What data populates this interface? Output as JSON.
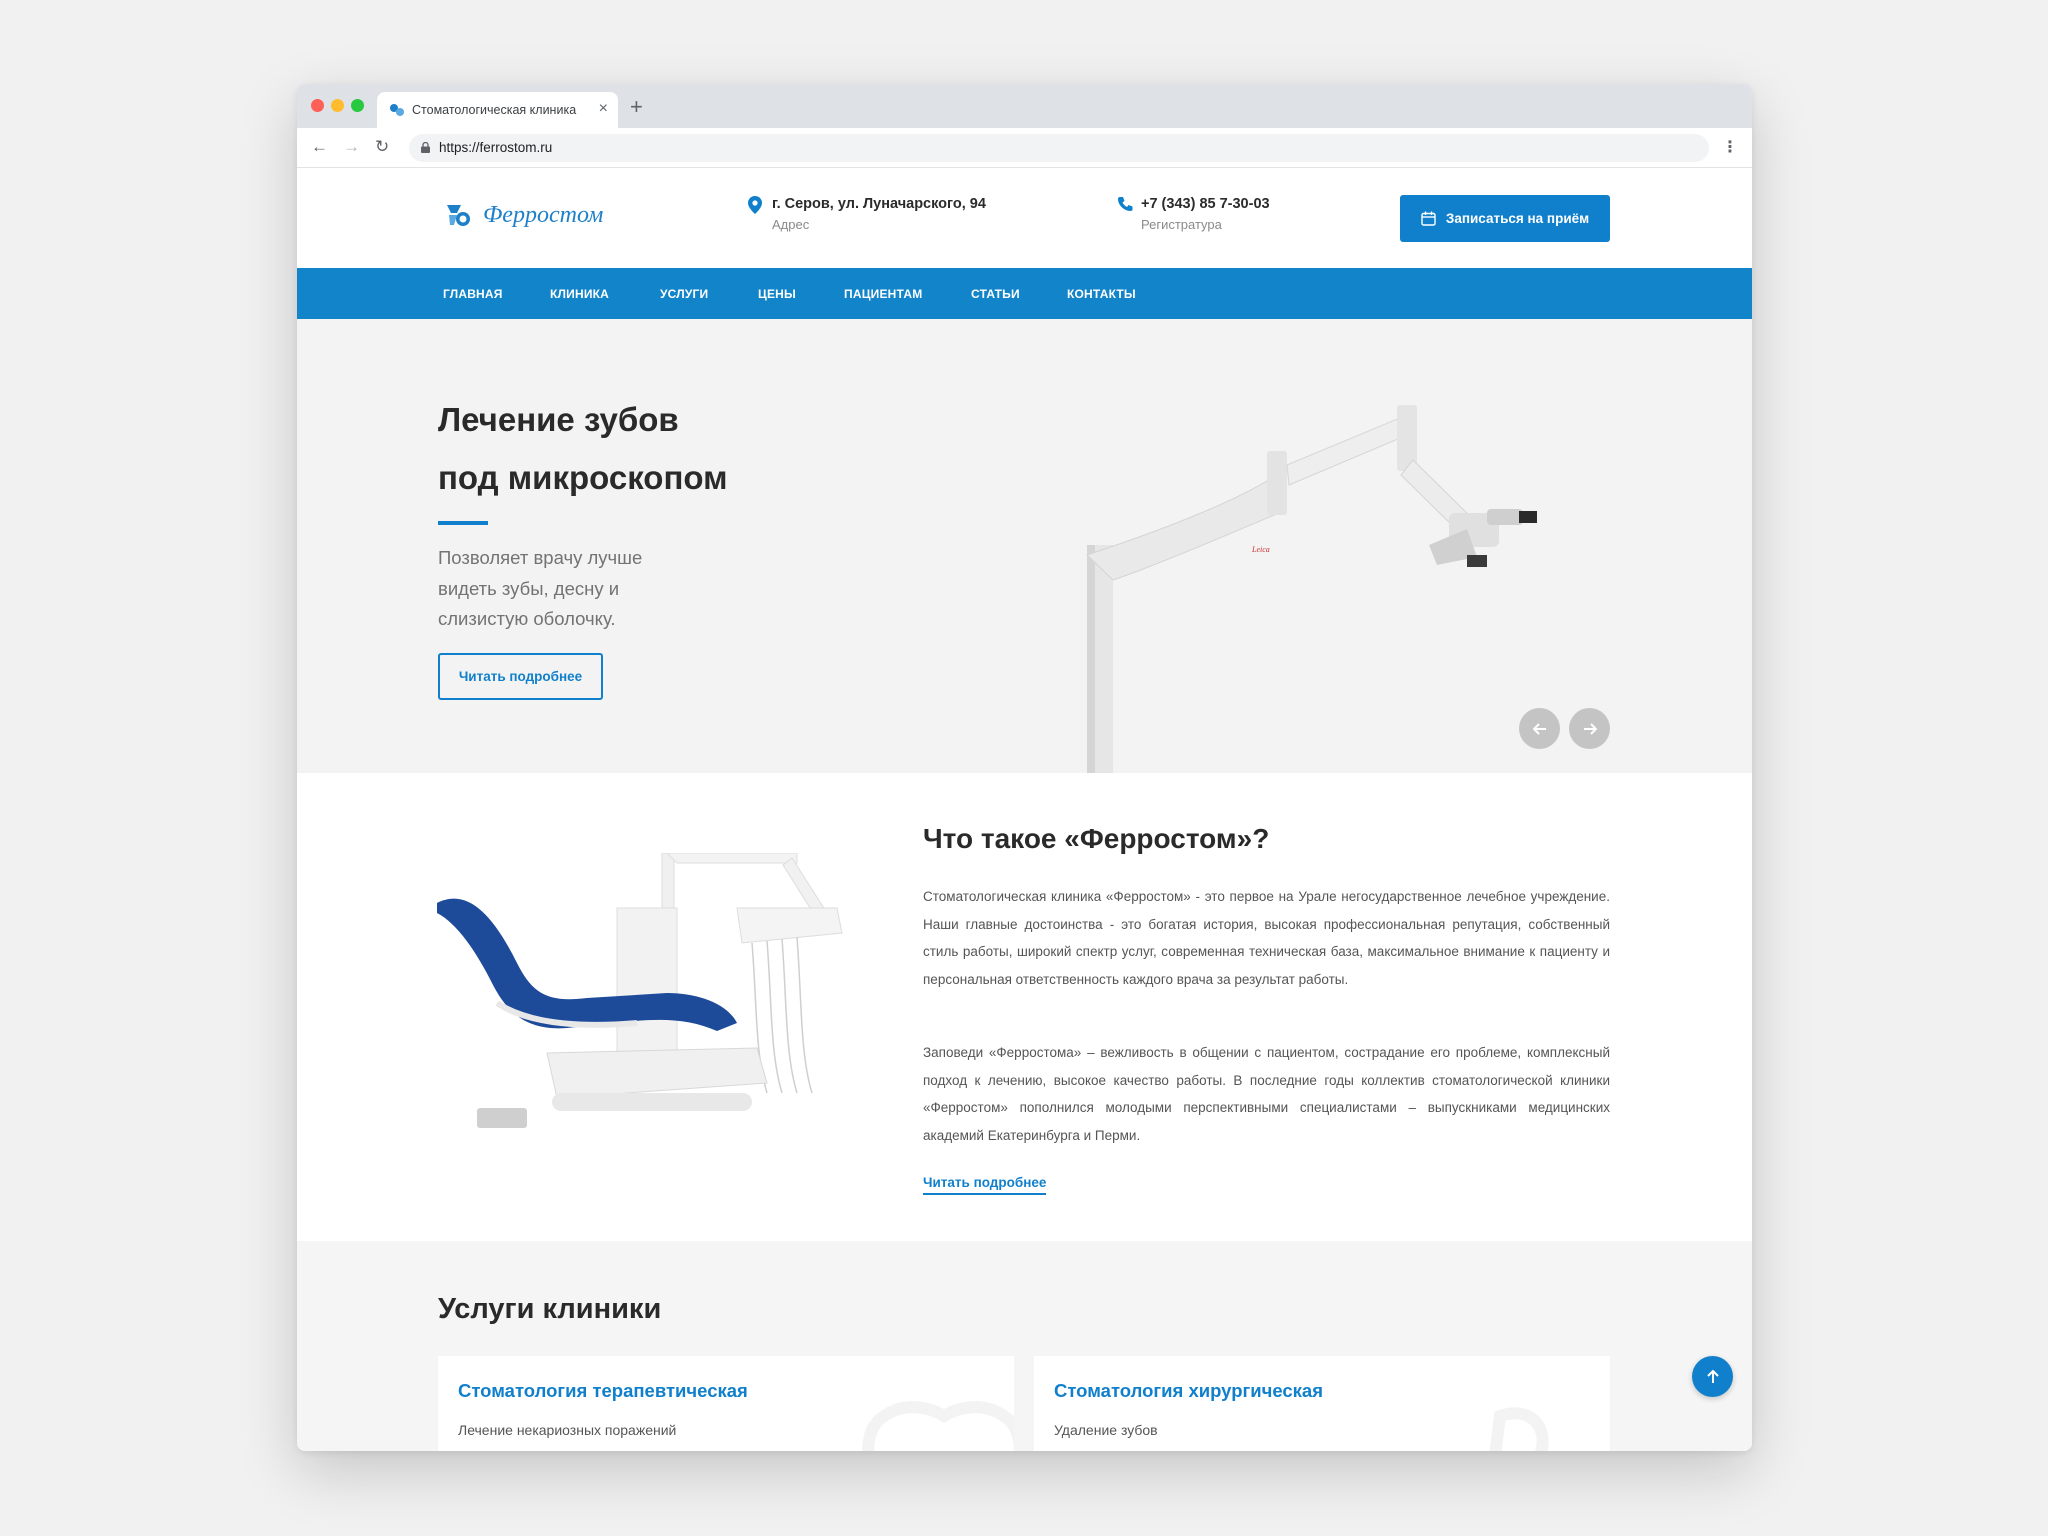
{
  "browser": {
    "tab_title": "Стоматологическая клиника",
    "url": "https://ferrostom.ru"
  },
  "header": {
    "logo_text": "Ферростом",
    "address": "г. Серов, ул. Луначарского, 94",
    "address_label": "Адрес",
    "phone": "+7 (343) 85 7-30-03",
    "phone_label": "Регистратура",
    "book_button": "Записаться на приём"
  },
  "nav": {
    "items": [
      "ГЛАВНАЯ",
      "КЛИНИКА",
      "УСЛУГИ",
      "ЦЕНЫ",
      "ПАЦИЕНТАМ",
      "СТАТЬИ",
      "КОНТАКТЫ"
    ]
  },
  "hero": {
    "title_line1": "Лечение зубов",
    "title_line2": "под микроскопом",
    "description": "Позволяет врачу лучше видеть зубы, десну и слизистую оболочку.",
    "button": "Читать подробнее"
  },
  "about": {
    "title": "Что такое «Ферростом»?",
    "paragraph1": "Стоматологическая клиника «Ферростом» - это первое на Урале негосударственное лечебное учреждение. Наши главные достоинства - это богатая история, высокая профессиональная репутация, собственный стиль работы, широкий спектр услуг, современная техническая база, максимальное внимание к пациенту и персональная ответственность каждого врача за результат работы.",
    "paragraph2": "Заповеди «Ферростома» – вежливость в общении с пациентом, сострадание его проблеме, комплексный подход к лечению, высокое качество работы. В последние годы коллектив стоматологической клиники «Ферростом» пополнился молодыми перспективными специалистами – выпускниками медицинских академий Екатеринбурга и Перми.",
    "link": "Читать подробнее"
  },
  "services": {
    "title": "Услуги клиники",
    "cards": [
      {
        "title": "Стоматология терапевтическая",
        "subtitle": "Лечение некариозных поражений"
      },
      {
        "title": "Стоматология хирургическая",
        "subtitle": "Удаление зубов"
      }
    ]
  },
  "colors": {
    "accent": "#1180cc",
    "nav": "#1184ca"
  }
}
